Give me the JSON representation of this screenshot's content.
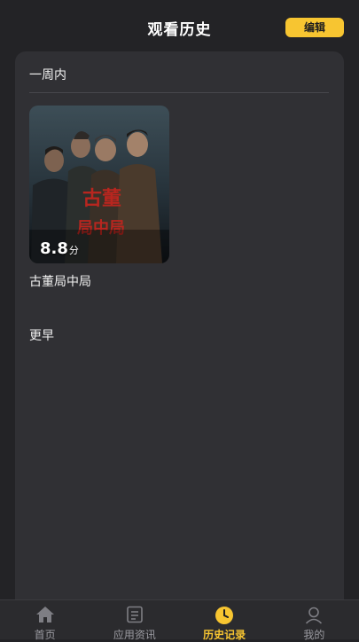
{
  "header": {
    "title": "观看历史",
    "edit_label": "编辑"
  },
  "sections": {
    "week": {
      "label": "一周内",
      "items": [
        {
          "title": "古董局中局",
          "score": "8.8",
          "score_unit": "分",
          "poster_text": "古董局中局"
        }
      ]
    },
    "earlier": {
      "label": "更早"
    }
  },
  "tabbar": {
    "tabs": [
      {
        "label": "首页",
        "icon": "home-icon"
      },
      {
        "label": "应用资讯",
        "icon": "document-icon"
      },
      {
        "label": "历史记录",
        "icon": "clock-icon",
        "active": true
      },
      {
        "label": "我的",
        "icon": "user-icon"
      }
    ]
  },
  "colors": {
    "accent": "#f7c531",
    "background": "#232326",
    "panel": "#303034"
  }
}
